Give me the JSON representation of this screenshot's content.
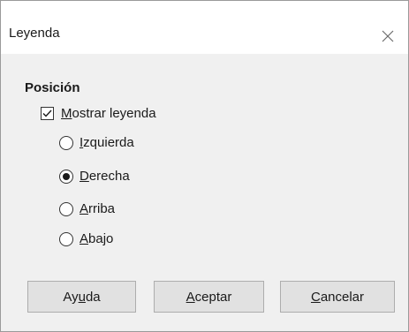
{
  "dialog": {
    "title": "Leyenda",
    "close_icon": "close-icon"
  },
  "position": {
    "section_title": "Posición",
    "show_legend": {
      "mnemonic": "M",
      "rest": "ostrar leyenda",
      "checked": true
    },
    "options": [
      {
        "mnemonic": "I",
        "rest": "zquierda",
        "selected": false
      },
      {
        "mnemonic": "D",
        "rest": "erecha",
        "selected": true
      },
      {
        "mnemonic": "A",
        "rest": "rriba",
        "selected": false
      },
      {
        "mnemonic": "A",
        "rest": "bajo",
        "selected": false
      }
    ]
  },
  "buttons": {
    "help": {
      "pre": "Ay",
      "mnemonic": "u",
      "post": "da"
    },
    "ok": {
      "pre": "",
      "mnemonic": "A",
      "post": "ceptar"
    },
    "cancel": {
      "pre": "",
      "mnemonic": "C",
      "post": "ancelar"
    }
  }
}
